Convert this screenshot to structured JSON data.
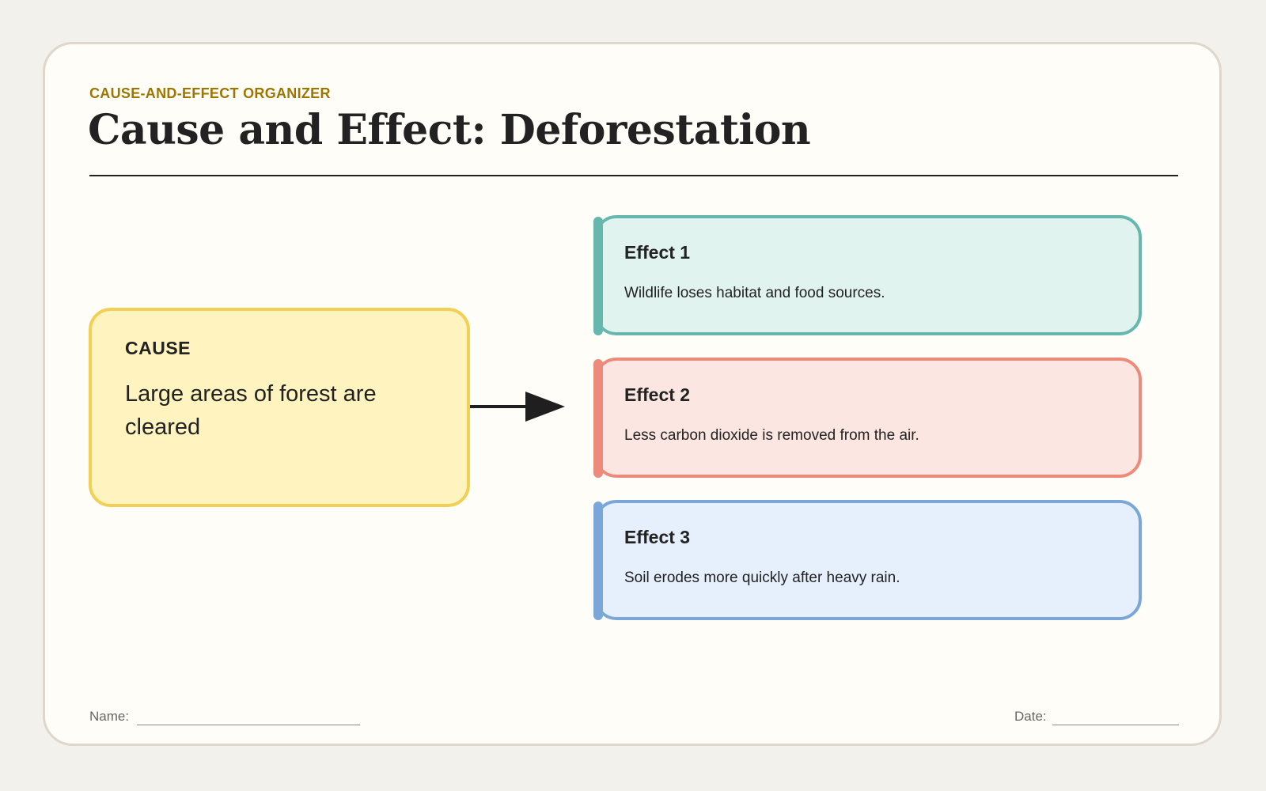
{
  "header": {
    "kicker": "CAUSE-AND-EFFECT ORGANIZER",
    "title": "Cause and Effect: Deforestation"
  },
  "cause": {
    "label": "CAUSE",
    "text": "Large areas of forest are cleared",
    "color": "#f2cf55",
    "fill": "#fff3bf"
  },
  "effects": [
    {
      "title": "Effect 1",
      "text": "Wildlife loses habitat and food sources.",
      "color": "#66b7ae",
      "fill": "#e0f3ef"
    },
    {
      "title": "Effect 2",
      "text": "Less carbon dioxide is removed from the air.",
      "color": "#ec8b7b",
      "fill": "#fce6e1"
    },
    {
      "title": "Effect 3",
      "text": "Soil erodes more quickly after heavy rain.",
      "color": "#7aa7d8",
      "fill": "#e6f0fc"
    }
  ],
  "footer": {
    "name_label": "Name:",
    "date_label": "Date:"
  },
  "colors": {
    "kicker": "#9c7600",
    "background": "#f3f1ec",
    "card": "#fffdf8"
  }
}
